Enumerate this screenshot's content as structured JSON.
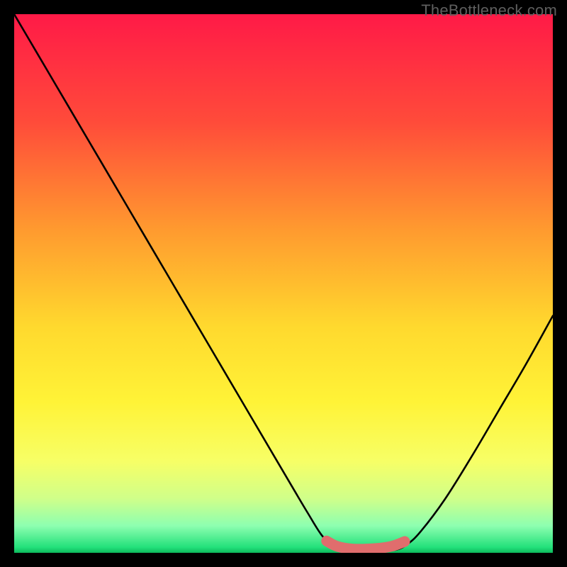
{
  "watermark": "TheBottleneck.com",
  "chart_data": {
    "type": "line",
    "title": "",
    "xlabel": "",
    "ylabel": "",
    "xlim": [
      0,
      100
    ],
    "ylim": [
      0,
      100
    ],
    "gradient_stops": [
      {
        "offset": 0.0,
        "color": "#ff1a47"
      },
      {
        "offset": 0.2,
        "color": "#ff4b3a"
      },
      {
        "offset": 0.4,
        "color": "#ff9a2f"
      },
      {
        "offset": 0.58,
        "color": "#ffd92e"
      },
      {
        "offset": 0.72,
        "color": "#fff337"
      },
      {
        "offset": 0.83,
        "color": "#f7ff66"
      },
      {
        "offset": 0.9,
        "color": "#cfff8a"
      },
      {
        "offset": 0.95,
        "color": "#8dffb0"
      },
      {
        "offset": 0.99,
        "color": "#22e07a"
      },
      {
        "offset": 1.0,
        "color": "#0db95c"
      }
    ],
    "series": [
      {
        "name": "bottleneck-curve",
        "points": [
          {
            "x": 0.0,
            "y": 100.0
          },
          {
            "x": 4.0,
            "y": 93.2
          },
          {
            "x": 8.0,
            "y": 86.4
          },
          {
            "x": 12.0,
            "y": 79.6
          },
          {
            "x": 16.0,
            "y": 72.8
          },
          {
            "x": 20.0,
            "y": 66.0
          },
          {
            "x": 24.0,
            "y": 59.2
          },
          {
            "x": 28.0,
            "y": 52.4
          },
          {
            "x": 32.0,
            "y": 45.6
          },
          {
            "x": 36.0,
            "y": 38.8
          },
          {
            "x": 40.0,
            "y": 32.0
          },
          {
            "x": 44.0,
            "y": 25.2
          },
          {
            "x": 48.0,
            "y": 18.4
          },
          {
            "x": 52.0,
            "y": 11.6
          },
          {
            "x": 54.5,
            "y": 7.4
          },
          {
            "x": 57.0,
            "y": 3.4
          },
          {
            "x": 59.0,
            "y": 1.4
          },
          {
            "x": 61.0,
            "y": 0.5
          },
          {
            "x": 64.0,
            "y": 0.2
          },
          {
            "x": 68.0,
            "y": 0.3
          },
          {
            "x": 71.0,
            "y": 0.6
          },
          {
            "x": 73.0,
            "y": 1.6
          },
          {
            "x": 75.5,
            "y": 4.0
          },
          {
            "x": 80.0,
            "y": 10.0
          },
          {
            "x": 85.0,
            "y": 18.0
          },
          {
            "x": 90.0,
            "y": 26.5
          },
          {
            "x": 95.0,
            "y": 35.0
          },
          {
            "x": 100.0,
            "y": 44.0
          }
        ]
      },
      {
        "name": "optimal-band",
        "points": [
          {
            "x": 58.0,
            "y": 2.2
          },
          {
            "x": 60.0,
            "y": 1.2
          },
          {
            "x": 63.0,
            "y": 0.7
          },
          {
            "x": 67.0,
            "y": 0.8
          },
          {
            "x": 70.0,
            "y": 1.2
          },
          {
            "x": 72.5,
            "y": 2.1
          }
        ]
      }
    ]
  }
}
